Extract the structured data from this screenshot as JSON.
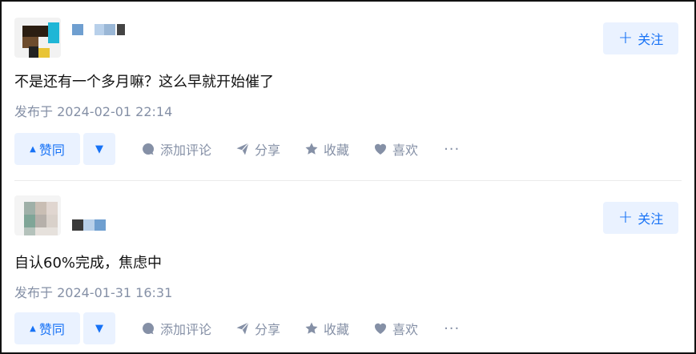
{
  "posts": [
    {
      "follow_label": "关注",
      "content": "不是还有一个多月嘛？这么早就开始催了",
      "time": "发布于 2024-02-01 22:14",
      "actions": {
        "upvote": "赞同",
        "comment": "添加评论",
        "share": "分享",
        "collect": "收藏",
        "like": "喜欢",
        "more": "···"
      }
    },
    {
      "follow_label": "关注",
      "content": "自认60%完成，焦虑中",
      "time": "发布于 2024-01-31 16:31",
      "actions": {
        "upvote": "赞同",
        "comment": "添加评论",
        "share": "分享",
        "collect": "收藏",
        "like": "喜欢",
        "more": "···"
      }
    }
  ],
  "icons": {
    "upvote": "triangle-up-icon",
    "downvote": "triangle-down-icon",
    "comment": "comment-bubble-icon",
    "share": "paper-plane-icon",
    "collect": "star-icon",
    "like": "heart-icon",
    "follow": "plus-icon"
  },
  "colors": {
    "accent": "#1772f6",
    "accent_bg": "#eaf2ff",
    "meta": "#8590a6",
    "text": "#121212"
  }
}
